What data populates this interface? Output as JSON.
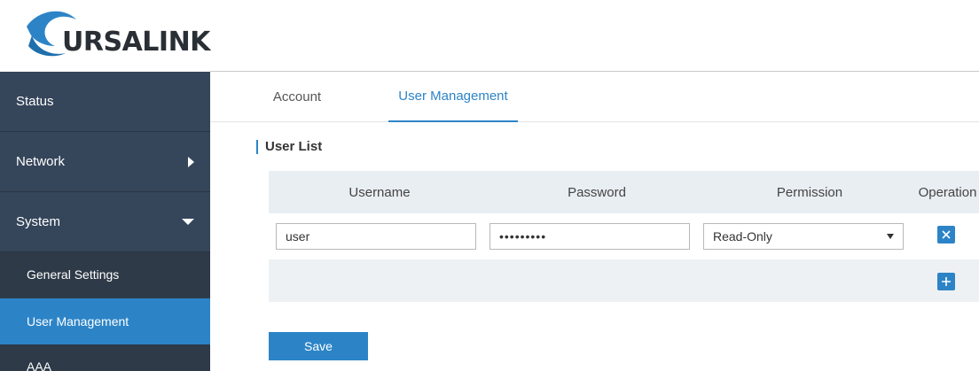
{
  "brand": {
    "logo_text": "URSALINK",
    "accent": "#2c84c7"
  },
  "sidebar": {
    "items": [
      {
        "label": "Status"
      },
      {
        "label": "Network"
      },
      {
        "label": "System"
      },
      {
        "label": "General Settings"
      },
      {
        "label": "User Management"
      },
      {
        "label": "AAA"
      }
    ]
  },
  "tabs": [
    {
      "label": "Account"
    },
    {
      "label": "User Management"
    }
  ],
  "user_list": {
    "title": "User List",
    "columns": [
      "Username",
      "Password",
      "Permission",
      "Operation"
    ],
    "rows": [
      {
        "username": "user",
        "password": "•••••••••",
        "permission": "Read-Only"
      }
    ]
  },
  "save_label": "Save"
}
